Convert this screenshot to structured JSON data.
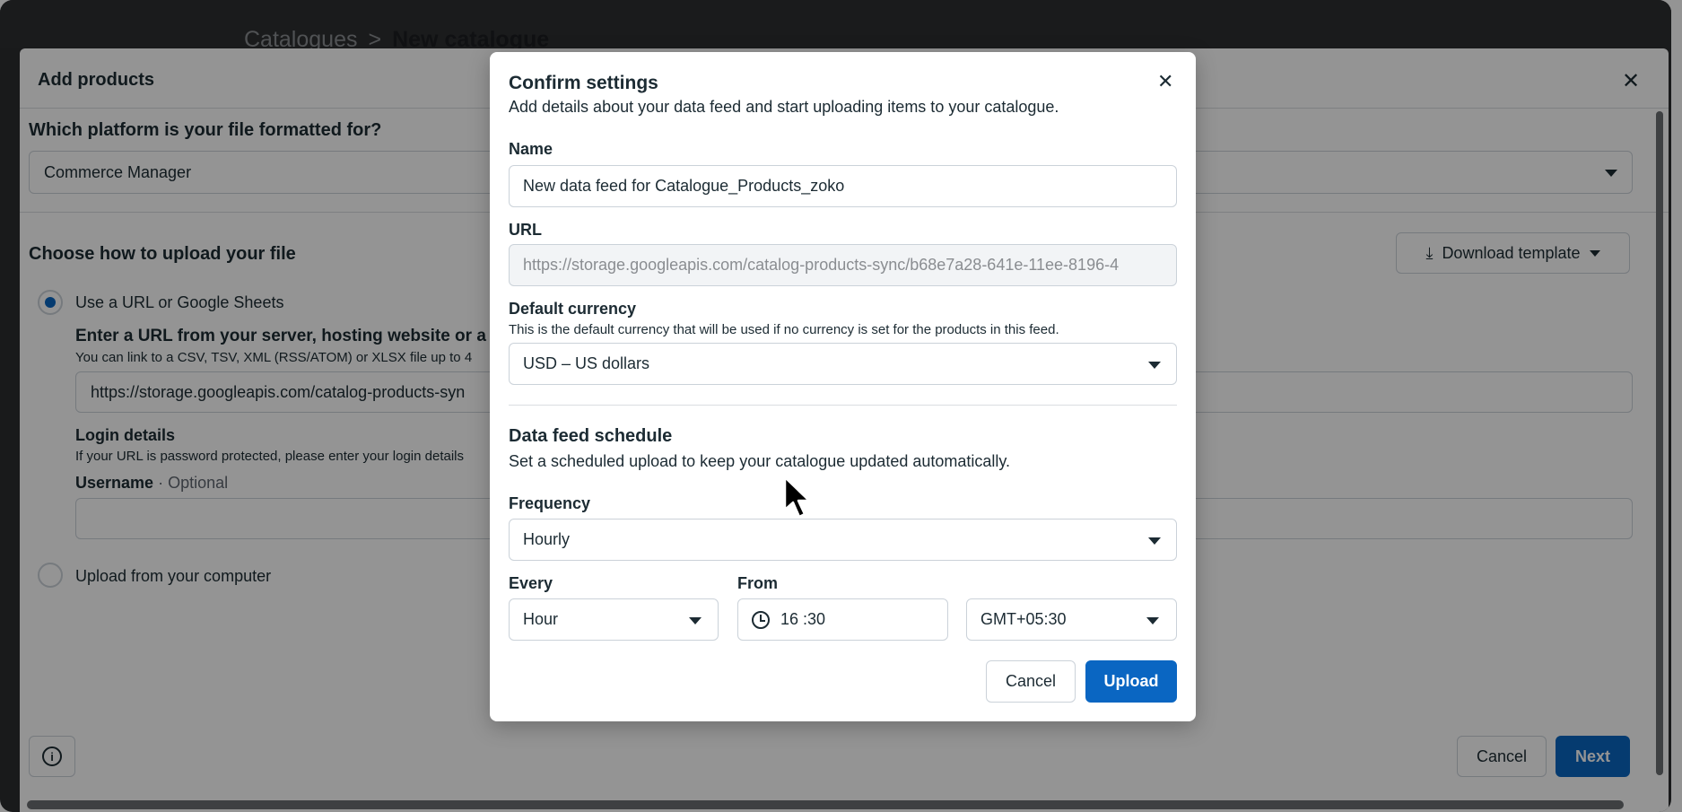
{
  "breadcrumb": {
    "parent": "Catalogues",
    "separator": ">",
    "current": "New catalogue"
  },
  "panel": {
    "title": "Add products",
    "platform_question": "Which platform is your file formatted for?",
    "platform_value": "Commerce Manager",
    "upload_heading": "Choose how to upload your file",
    "download_template_label": "Download template",
    "option_url_label": "Use a URL or Google Sheets",
    "url_heading": "Enter a URL from your server, hosting website or a",
    "url_help": "You can link to a CSV, TSV, XML (RSS/ATOM) or XLSX file up to 4",
    "url_value": "https://storage.googleapis.com/catalog-products-syn",
    "login_heading": "Login details",
    "login_help": "If your URL is password protected, please enter your login details",
    "username_label": "Username",
    "username_dot": "·",
    "username_optional": "Optional",
    "option_computer_label": "Upload from your computer",
    "cancel_label": "Cancel",
    "next_label": "Next",
    "info_icon": "info-icon",
    "close_icon": "close-icon"
  },
  "modal": {
    "title": "Confirm settings",
    "subtitle": "Add details about your data feed and start uploading items to your catalogue.",
    "name_label": "Name",
    "name_value": "New data feed for Catalogue_Products_zoko",
    "url_label": "URL",
    "url_value": "https://storage.googleapis.com/catalog-products-sync/b68e7a28-641e-11ee-8196-4",
    "currency_label": "Default currency",
    "currency_help": "This is the default currency that will be used if no currency is set for the products in this feed.",
    "currency_value": "USD – US dollars",
    "schedule_heading": "Data feed schedule",
    "schedule_help": "Set a scheduled upload to keep your catalogue updated automatically.",
    "frequency_label": "Frequency",
    "frequency_value": "Hourly",
    "every_label": "Every",
    "every_value": "Hour",
    "from_label": "From",
    "from_value": "16 :30",
    "timezone_value": "GMT+05:30",
    "cancel_label": "Cancel",
    "upload_label": "Upload"
  },
  "colors": {
    "primary": "#0a66c2",
    "overlay": "rgba(0,0,0,0.42)"
  }
}
